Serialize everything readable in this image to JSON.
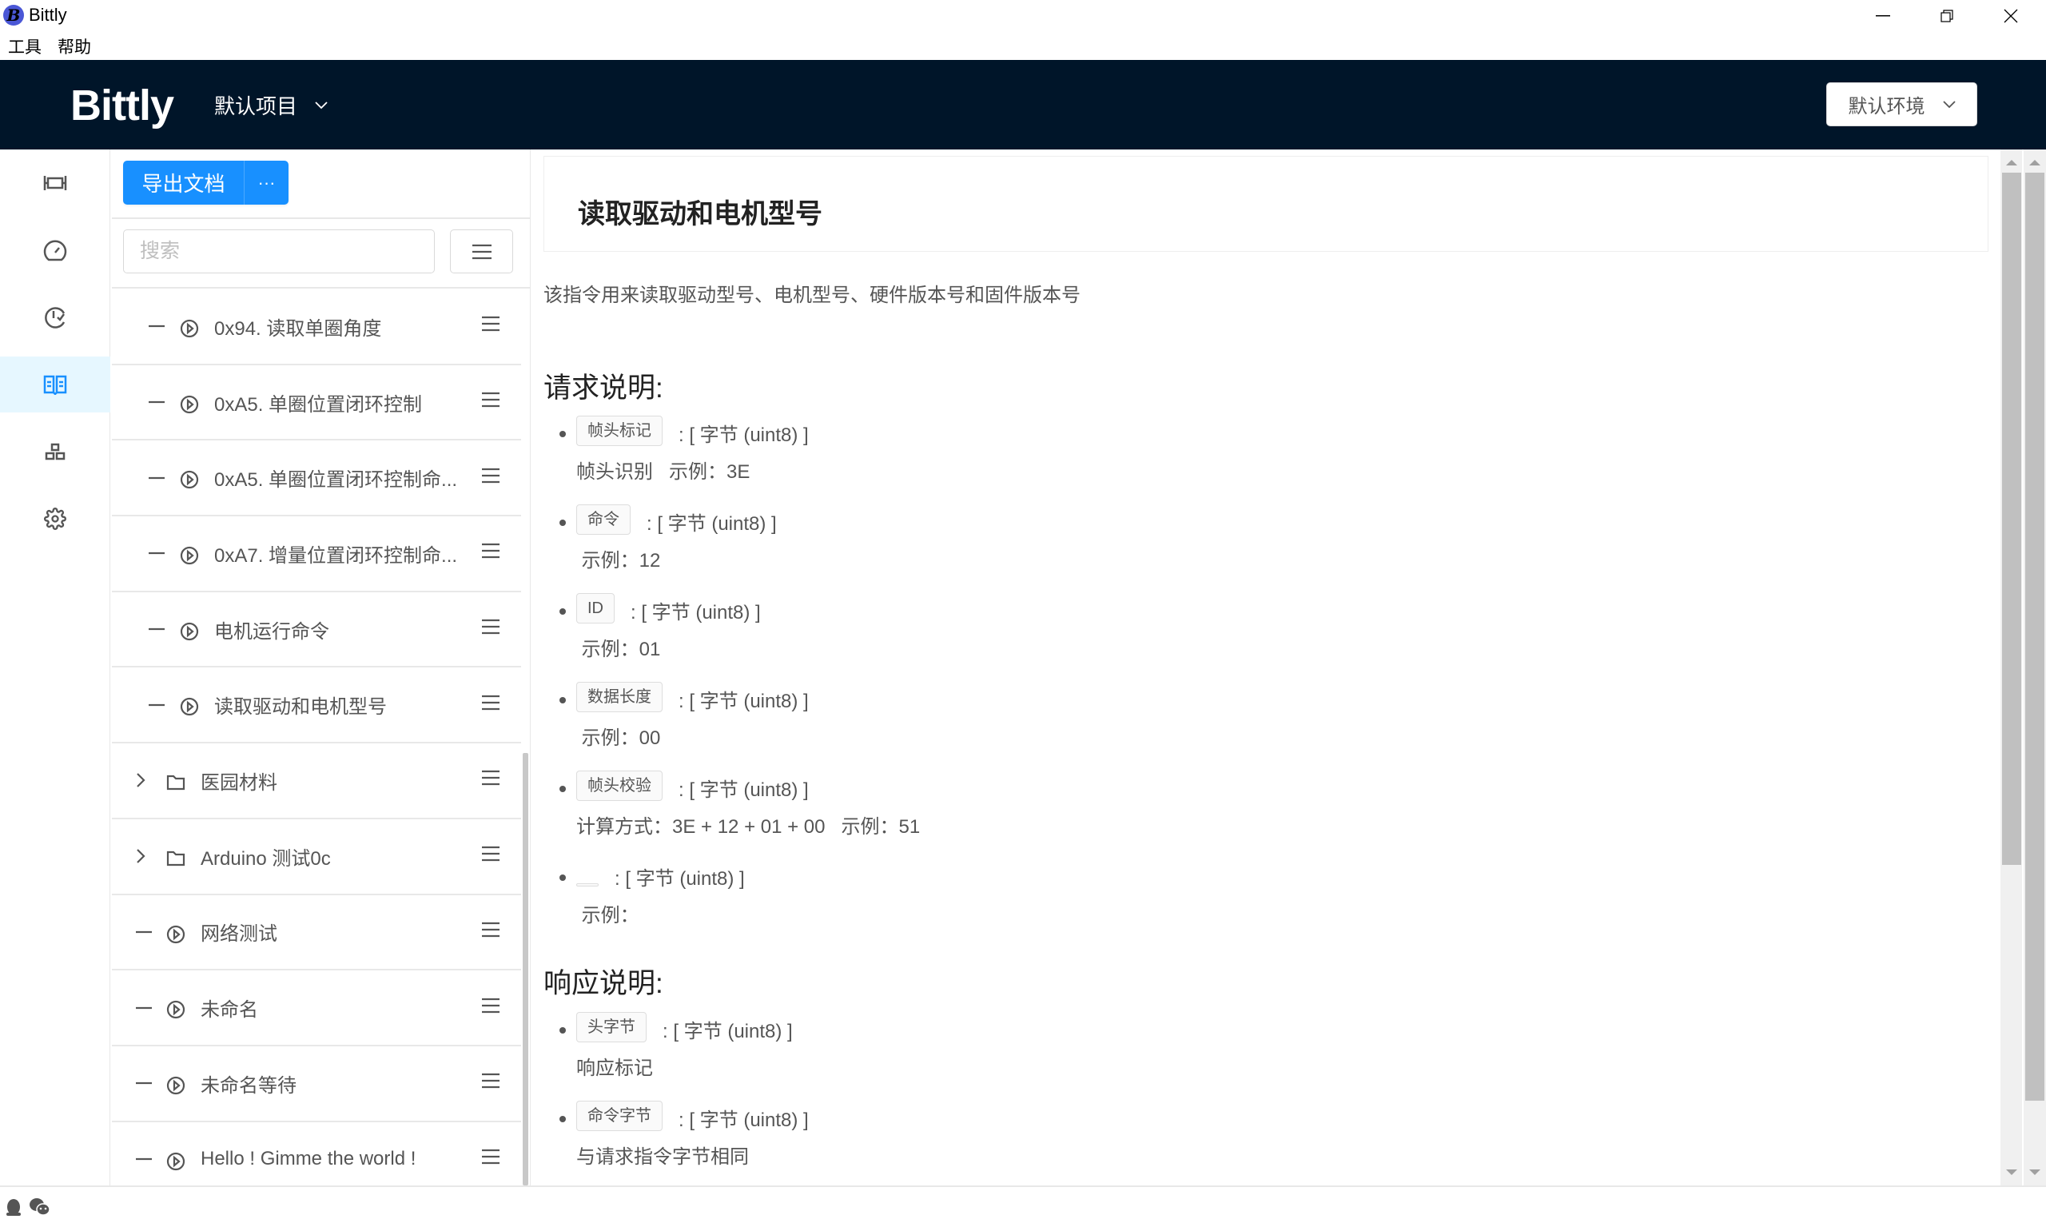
{
  "window": {
    "title": "Bittly",
    "menu": [
      "工具",
      "帮助"
    ]
  },
  "header": {
    "logo": "Bittly",
    "project": "默认项目",
    "environment": "默认环境",
    "bg_color": "#001529"
  },
  "sidebar": {
    "items": [
      {
        "icon": "serial-port-icon"
      },
      {
        "icon": "dashboard-icon"
      },
      {
        "icon": "history-check-icon"
      },
      {
        "icon": "book-icon",
        "active": true
      },
      {
        "icon": "modules-icon"
      },
      {
        "icon": "gear-icon"
      }
    ],
    "accent_color": "#1890ff"
  },
  "tree": {
    "export_label": "导出文档",
    "more_label": "···",
    "search_placeholder": "搜索",
    "items": [
      {
        "type": "child",
        "label": "0x94. 读取单圈角度"
      },
      {
        "type": "child",
        "label": "0xA5. 单圈位置闭环控制"
      },
      {
        "type": "child",
        "label": "0xA5. 单圈位置闭环控制命..."
      },
      {
        "type": "child",
        "label": "0xA7. 增量位置闭环控制命..."
      },
      {
        "type": "child",
        "label": "电机运行命令"
      },
      {
        "type": "child",
        "label": "读取驱动和电机型号"
      },
      {
        "type": "folder",
        "label": "医园材料"
      },
      {
        "type": "folder",
        "label": "Arduino 测试0c"
      },
      {
        "type": "top",
        "label": "网络测试"
      },
      {
        "type": "top",
        "label": "未命名"
      },
      {
        "type": "top",
        "label": "未命名等待"
      },
      {
        "type": "top",
        "label": "Hello ! Gimme the world !"
      }
    ]
  },
  "doc": {
    "title": "读取驱动和电机型号",
    "description": "该指令用来读取驱动型号、电机型号、硬件版本号和固件版本号",
    "request_heading": "请求说明:",
    "request_fields": [
      {
        "name": "帧头标记",
        "type": ": [ 字节 (uint8) ]",
        "sub": "帧头识别   示例：3E"
      },
      {
        "name": "命令",
        "type": ": [ 字节 (uint8) ]",
        "sub": " 示例：12"
      },
      {
        "name": "ID",
        "type": ": [ 字节 (uint8) ]",
        "sub": " 示例：01"
      },
      {
        "name": "数据长度",
        "type": ": [ 字节 (uint8) ]",
        "sub": " 示例：00"
      },
      {
        "name": "帧头校验",
        "type": ": [ 字节 (uint8) ]",
        "sub": "计算方式：3E + 12 + 01 + 00   示例：51"
      },
      {
        "name": "",
        "type": ": [ 字节 (uint8) ]",
        "sub": " 示例："
      }
    ],
    "response_heading": "响应说明:",
    "response_fields": [
      {
        "name": "头字节",
        "type": ": [ 字节 (uint8) ]",
        "sub": "响应标记"
      },
      {
        "name": "命令字节",
        "type": ": [ 字节 (uint8) ]",
        "sub": "与请求指令字节相同"
      }
    ]
  },
  "statusbar": {
    "icons": [
      "qq-icon",
      "wechat-icon"
    ]
  }
}
